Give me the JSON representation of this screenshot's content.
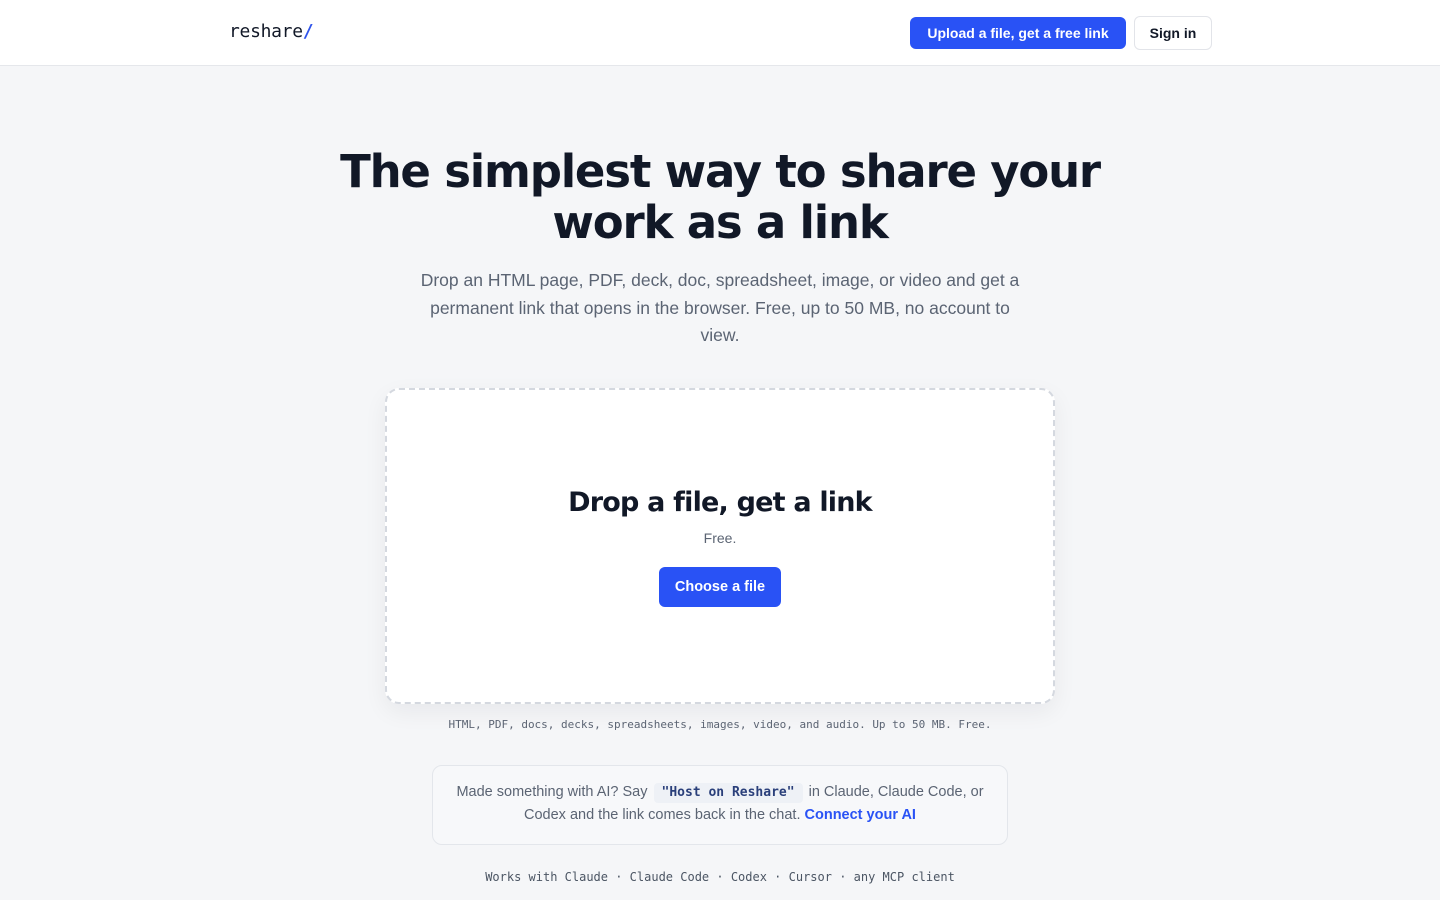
{
  "header": {
    "logo_text": "reshare",
    "logo_slash": "/",
    "upload_label": "Upload a file, get a free link",
    "signin_label": "Sign in"
  },
  "hero": {
    "title": "The simplest way to share your work as a link",
    "subtitle": "Drop an HTML page, PDF, deck, doc, spreadsheet, image, or video and get a permanent link that opens in the browser. Free, up to 50 MB, no account to view."
  },
  "dropzone": {
    "title": "Drop a file, get a link",
    "note": "Free.",
    "choose_label": "Choose a file"
  },
  "formats_text": "HTML, PDF, docs, decks, spreadsheets, images, video, and audio. Up to 50 MB. Free.",
  "ai_prompt": {
    "text_before": "Made something with AI? Say",
    "command": "\"Host on Reshare\"",
    "text_after": "in Claude, Claude Code, or Codex and the link comes back in the chat.",
    "link_label": "Connect your AI"
  },
  "works_with": "Works with Claude · Claude Code · Codex · Cursor · any MCP client",
  "colors": {
    "accent": "#2952f5",
    "background": "#f5f6f8",
    "text": "#111827",
    "muted": "#5b6473"
  }
}
